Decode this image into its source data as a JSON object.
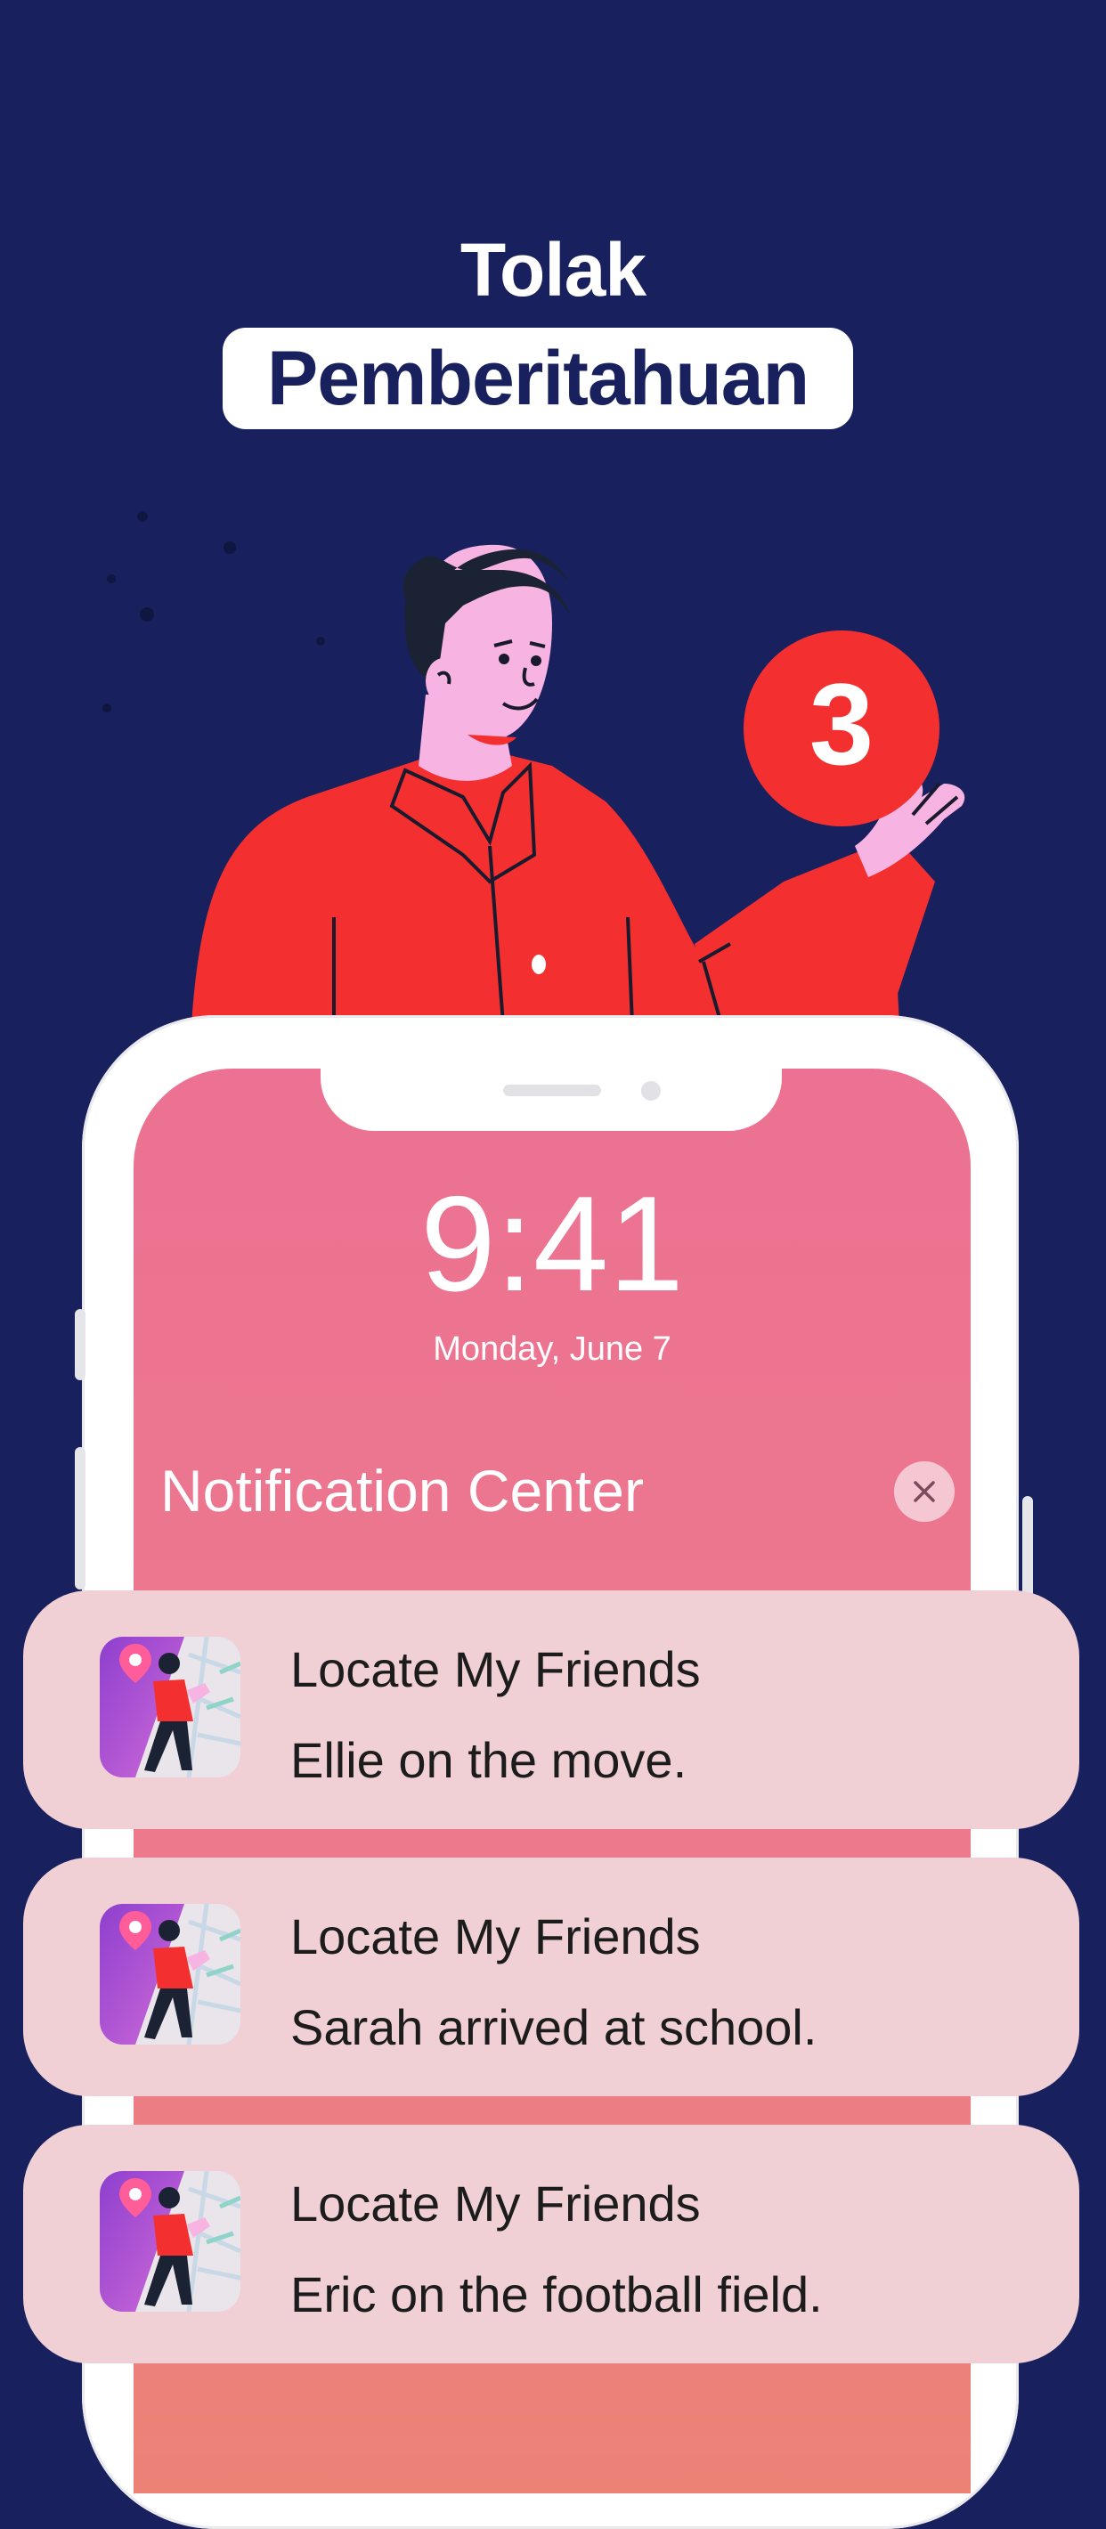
{
  "header": {
    "line1": "Tolak",
    "line2": "Pemberitahuan"
  },
  "illustration": {
    "badge_count": "3"
  },
  "lock_screen": {
    "time": "9:41",
    "date": "Monday, June 7",
    "notification_center_title": "Notification Center",
    "close_icon": "close-icon"
  },
  "notifications": [
    {
      "app_name": "Locate My Friends",
      "message": "Ellie on the move."
    },
    {
      "app_name": "Locate My Friends",
      "message": "Sarah arrived at school."
    },
    {
      "app_name": "Locate My Friends",
      "message": "Eric on the football field."
    }
  ],
  "colors": {
    "background": "#18215e",
    "accent_red": "#f3302f",
    "screen_pink": "#ec7192",
    "card": "#f0d0d5"
  }
}
